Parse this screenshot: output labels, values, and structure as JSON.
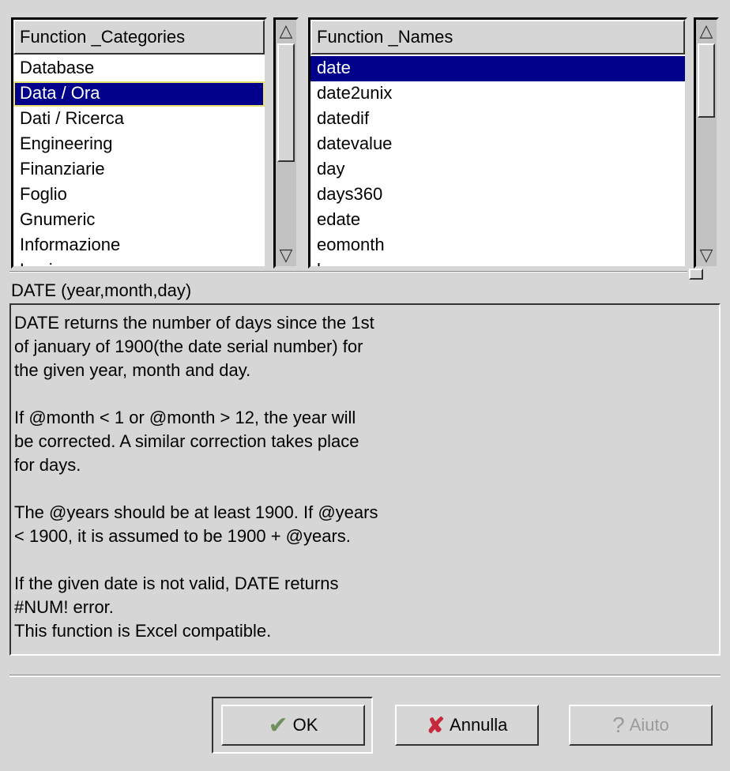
{
  "categories": {
    "header": "Function _Categories",
    "items": [
      "Database",
      "Data / Ora",
      "Dati / Ricerca",
      "Engineering",
      "Finanziarie",
      "Foglio",
      "Gnumeric",
      "Informazione",
      "Logica"
    ],
    "selected": "Data / Ora"
  },
  "names": {
    "header": "Function _Names",
    "items": [
      "date",
      "date2unix",
      "datedif",
      "datevalue",
      "day",
      "days360",
      "edate",
      "eomonth",
      "hour"
    ],
    "selected": "date"
  },
  "signature": "DATE (year,month,day)",
  "description": "DATE returns the number of days since the 1st\nof january of 1900(the date serial number) for\nthe given year, month and day.\n\nIf @month < 1 or @month > 12, the year will\nbe corrected. A similar correction takes place\nfor days.\n\nThe @years should be at least 1900. If @years\n< 1900, it is assumed to be 1900 + @years.\n\nIf the given date is not valid, DATE returns\n#NUM! error.\nThis function is Excel compatible.",
  "buttons": {
    "ok": "OK",
    "cancel": "Annulla",
    "help": "Aiuto"
  },
  "colors": {
    "selection": "#00008b",
    "background": "#d6d6d6"
  }
}
